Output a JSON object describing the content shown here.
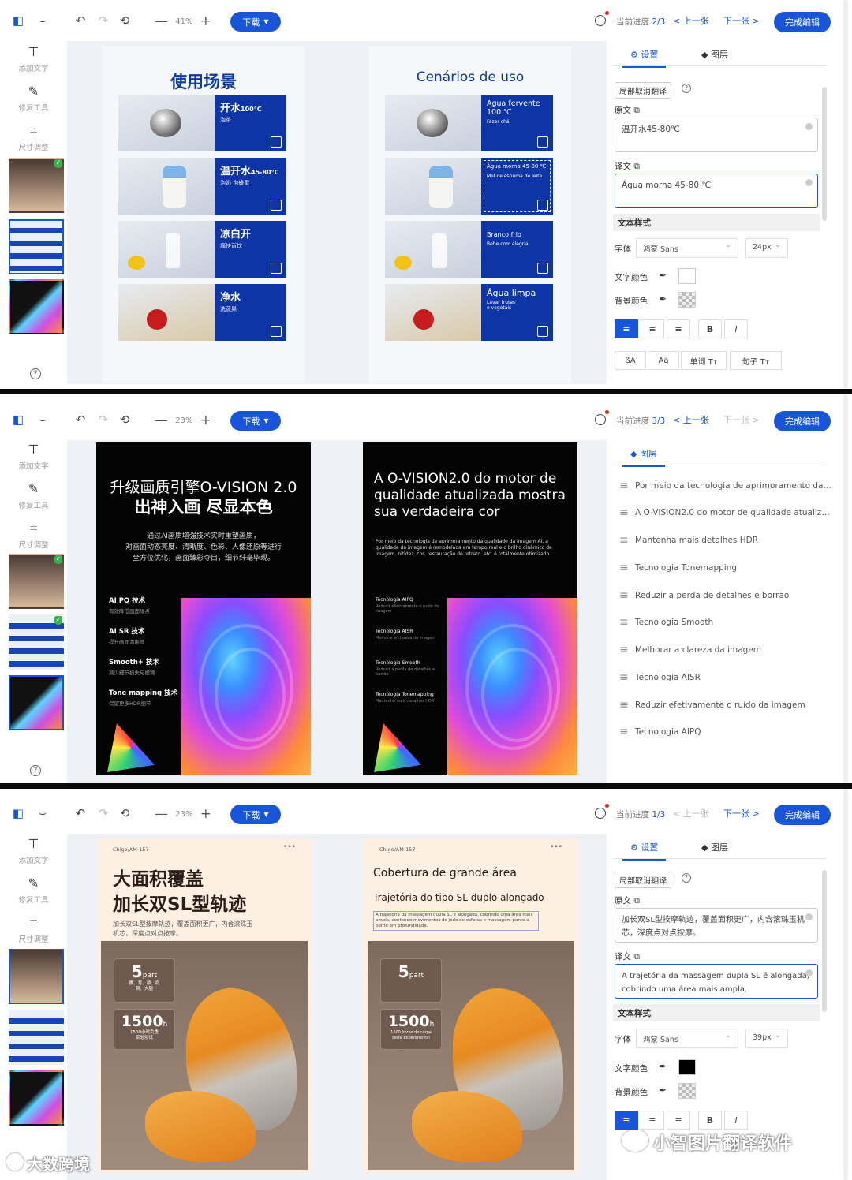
{
  "toolbar": {
    "zoom_out": "—",
    "zoom_in": "+",
    "download": "下载",
    "finish": "完成编辑",
    "prev": "上一张",
    "next": "下一张",
    "progress_prefix": "当前进度"
  },
  "tools": [
    {
      "label": "添加文字",
      "icon": "text-icon"
    },
    {
      "label": "修复工具",
      "icon": "magic-wand-icon"
    },
    {
      "label": "尺寸调整",
      "icon": "crop-icon"
    }
  ],
  "colors": {
    "accent": "#1955d8",
    "navy": "#0e35a6",
    "canvas_bg": "#eef1f5"
  },
  "panel1": {
    "zoom": "41%",
    "progress_num": "2/3",
    "tab_settings": "设置",
    "tab_layers": "图层",
    "cancel_local": "局部取消翻译",
    "source_label": "原文",
    "source_text": "温开水45-80℃",
    "target_label": "译文",
    "target_text": "Água morna 45-80 ℃",
    "style_section": "文本样式",
    "font_label": "字体",
    "font_value": "鸿蒙 Sans",
    "size_value": "24px",
    "text_color_label": "文字颜色",
    "bg_color_label": "背景颜色",
    "bold": "B",
    "italic": "I",
    "case_btns": [
      "ßA",
      "Aā",
      "单词 Tт",
      "句子 Tт"
    ],
    "original": {
      "title": "使用场景",
      "rows": [
        {
          "h": "开水",
          "sup": "100°C",
          "s": "泡茶"
        },
        {
          "h": "温开水",
          "sup": "45-80°C",
          "s": "泡奶 泡蜂蜜"
        },
        {
          "h": "凉白开",
          "sup": "",
          "s": "痛快直饮"
        },
        {
          "h": "净水",
          "sup": "",
          "s": "洗蔬果"
        }
      ]
    },
    "translated": {
      "title": "Cenários de uso",
      "rows": [
        {
          "t": "Água fervente\n100 ℃",
          "s": "Fazer chá"
        },
        {
          "t": "Água morna 45-80 ℃",
          "s": "Mel de espuma de leite"
        },
        {
          "t": "Branco frio",
          "s": "Bebe com alegria"
        },
        {
          "t": "Água limpa",
          "s": "Lavar frutas\ne vegetais"
        }
      ]
    }
  },
  "panel2": {
    "zoom": "23%",
    "progress_num": "3/3",
    "tab_layers": "图层",
    "layers": [
      "Por meio da tecnologia de aprimoramento da q...",
      "A O-VISION2.0 do motor de qualidade atualiza...",
      "Mantenha mais detalhes HDR",
      "Tecnologia Tonemapping",
      "Reduzir a perda de detalhes e borrão",
      "Tecnologia Smooth",
      "Melhorar a clareza da imagem",
      "Tecnologia AISR",
      "Reduzir efetivamente o ruído da imagem",
      "Tecnologia AIPQ"
    ],
    "original": {
      "title1": "升级画质引擎O-VISION 2.0",
      "title2": "出神入画 尽显本色",
      "desc": "通过AI画质增强技术实时重塑画质，\n对画面动态亮度、清晰度、色彩、人像还原等进行\n全方位优化，画面臻彩夺目，细节纤毫毕现。",
      "features": [
        {
          "h": "AI PQ 技术",
          "s": "有效降低画面噪点"
        },
        {
          "h": "AI SR 技术",
          "s": "提升画面清晰度"
        },
        {
          "h": "Smooth+ 技术",
          "s": "减少细节损失与模糊"
        },
        {
          "h": "Tone mapping 技术",
          "s": "保留更多HDR细节"
        }
      ]
    },
    "translated": {
      "title": "A O-VISION2.0 do motor de qualidade atualizada mostra sua verdadeira cor",
      "desc": "Por meio da tecnologia de aprimoramento da qualidade da imagem AI, a qualidade da imagem é remodelada em tempo real e o brilho dinâmico da imagem, nitidez, cor, restauração de retrato, etc. é totalmente otimizado.",
      "features": [
        {
          "h": "Tecnologia AIPQ",
          "s": "Reduzir efetivamente o ruído da imagem"
        },
        {
          "h": "Tecnologia AISR",
          "s": "Melhorar a clareza da imagem"
        },
        {
          "h": "Tecnologia Smooth",
          "s": "Reduzir a perda de detalhes e borrão"
        },
        {
          "h": "Tecnologia Tonemapping",
          "s": "Mantenha mais detalhes HDR"
        }
      ]
    }
  },
  "panel3": {
    "zoom": "23%",
    "progress_num": "1/3",
    "tab_settings": "设置",
    "tab_layers": "图层",
    "cancel_local": "局部取消翻译",
    "source_label": "原文",
    "source_text": "加长双SL型按摩轨迹，覆盖面积更广，内含滚珠玉机芯，深度点对点按摩。",
    "target_label": "译文",
    "target_text": "A trajetória da massagem dupla SL é alongada, cobrindo uma área mais ampla.",
    "style_section": "文本样式",
    "font_label": "字体",
    "font_value": "鸿蒙 Sans",
    "size_value": "39px",
    "text_color_label": "文字颜色",
    "bg_color_label": "背景颜色",
    "bold": "B",
    "italic": "I",
    "original": {
      "brand": "Chigo/AM-157",
      "more": "•••",
      "title1": "大面积覆盖",
      "title2": "加长双SL型轨迹",
      "desc": "加长双SL型按摩轨迹，覆盖面积更广，内含滚珠玉\n机芯，深度点对点按摩。",
      "badge1_num": "5",
      "badge1_unit": "part",
      "badge1_sub": "腰、背、颈、肩\n臀、大腿",
      "badge2_num": "1500",
      "badge2_unit": "h",
      "badge2_sub": "1500小时负重\n实验测试"
    },
    "translated": {
      "brand": "Chigo/AM-157",
      "more": "•••",
      "title1": "Cobertura de grande área",
      "title2": "Trajetória do tipo SL duplo alongado",
      "desc": "A trajetória da massagem dupla SL é alongada, cobrindo uma área mais ampla, contendo movimentos de jade de esferas e massagem ponto a ponto em profundidade.",
      "badge1_num": "5",
      "badge1_unit": "part",
      "badge2_num": "1500",
      "badge2_unit": "h",
      "badge2_sub": "1500 horas de carga\nteste experimental"
    }
  },
  "watermarks": {
    "left": "大数跨境",
    "right": "小智图片翻译软件"
  }
}
